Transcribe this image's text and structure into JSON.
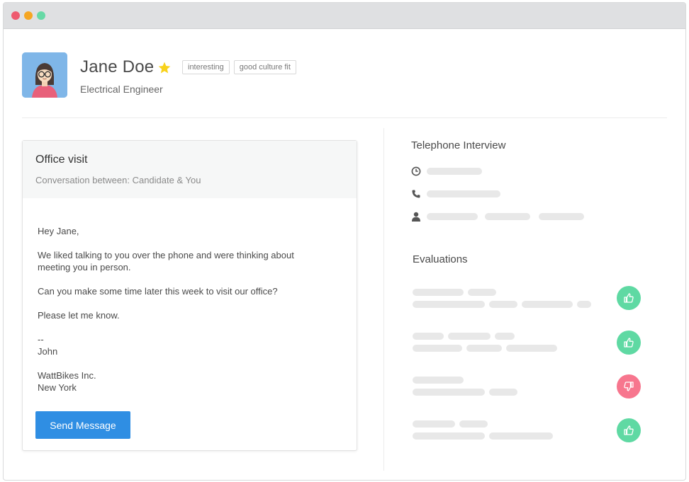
{
  "window": {
    "controls": [
      {
        "name": "close",
        "color": "#ee5a6f"
      },
      {
        "name": "minimize",
        "color": "#f5a623"
      },
      {
        "name": "maximize",
        "color": "#67d9a6"
      }
    ]
  },
  "profile": {
    "name": "Jane Doe",
    "role": "Electrical Engineer",
    "starred": true,
    "tags": [
      "interesting",
      "good culture fit"
    ]
  },
  "message_card": {
    "title": "Office visit",
    "subtitle": "Conversation between: Candidate & You",
    "body": {
      "greeting": "Hey Jane,",
      "para1_line1": "We liked talking to you over the phone and were thinking about",
      "para1_line2": "meeting you in person.",
      "para2": "Can you make some time later this week to visit our office?",
      "para3": "Please let me know.",
      "sig_dash": "--",
      "sig_name": "John",
      "company": "WattBikes Inc.",
      "city": "New York"
    },
    "send_label": "Send Message"
  },
  "telephone": {
    "title": "Telephone Interview",
    "rows": [
      {
        "icon": "clock-icon"
      },
      {
        "icon": "phone-icon"
      },
      {
        "icon": "person-icon"
      }
    ]
  },
  "evaluations": {
    "title": "Evaluations",
    "items": [
      {
        "verdict": "thumbs-up",
        "color": "#5fd9a3"
      },
      {
        "verdict": "thumbs-up",
        "color": "#5fd9a3"
      },
      {
        "verdict": "thumbs-down",
        "color": "#f7768e"
      },
      {
        "verdict": "thumbs-up",
        "color": "#5fd9a3"
      }
    ]
  }
}
